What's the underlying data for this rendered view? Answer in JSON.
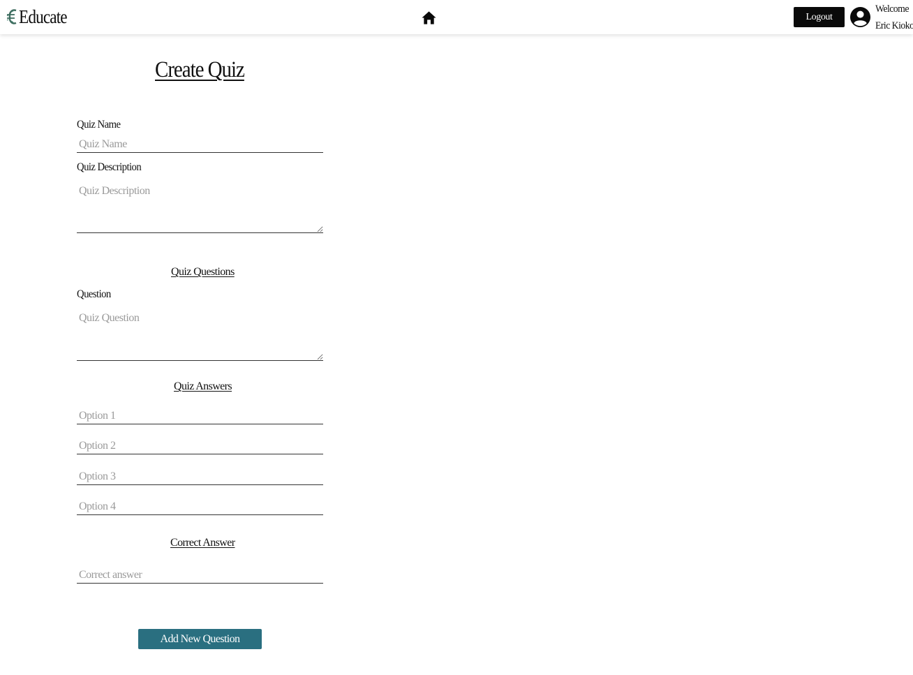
{
  "header": {
    "brand": "Educate",
    "brand_icon": "euro-leaf-logo-icon",
    "home_icon": "home-icon",
    "logout_label": "Logout",
    "avatar_icon": "user-circle-icon",
    "welcome_line1": "Welcome",
    "welcome_line2": "Eric Kioko"
  },
  "form": {
    "title": "Create Quiz",
    "quiz_name_label": "Quiz Name",
    "quiz_name_placeholder": "Quiz Name",
    "quiz_description_label": "Quiz Description",
    "quiz_description_placeholder": "Quiz Description",
    "questions_section": "Quiz Questions",
    "question_label": "Question",
    "question_placeholder": "Quiz Question",
    "answers_section": "Quiz Answers",
    "options": [
      {
        "placeholder": "Option 1"
      },
      {
        "placeholder": "Option 2"
      },
      {
        "placeholder": "Option 3"
      },
      {
        "placeholder": "Option 4"
      }
    ],
    "correct_section": "Correct Answer",
    "correct_placeholder": "Correct answer",
    "add_button": "Add New Question"
  },
  "colors": {
    "accent": "#2a6f80",
    "logout_bg": "#0a0a0a",
    "brand_icon": "#3d6b5e"
  }
}
